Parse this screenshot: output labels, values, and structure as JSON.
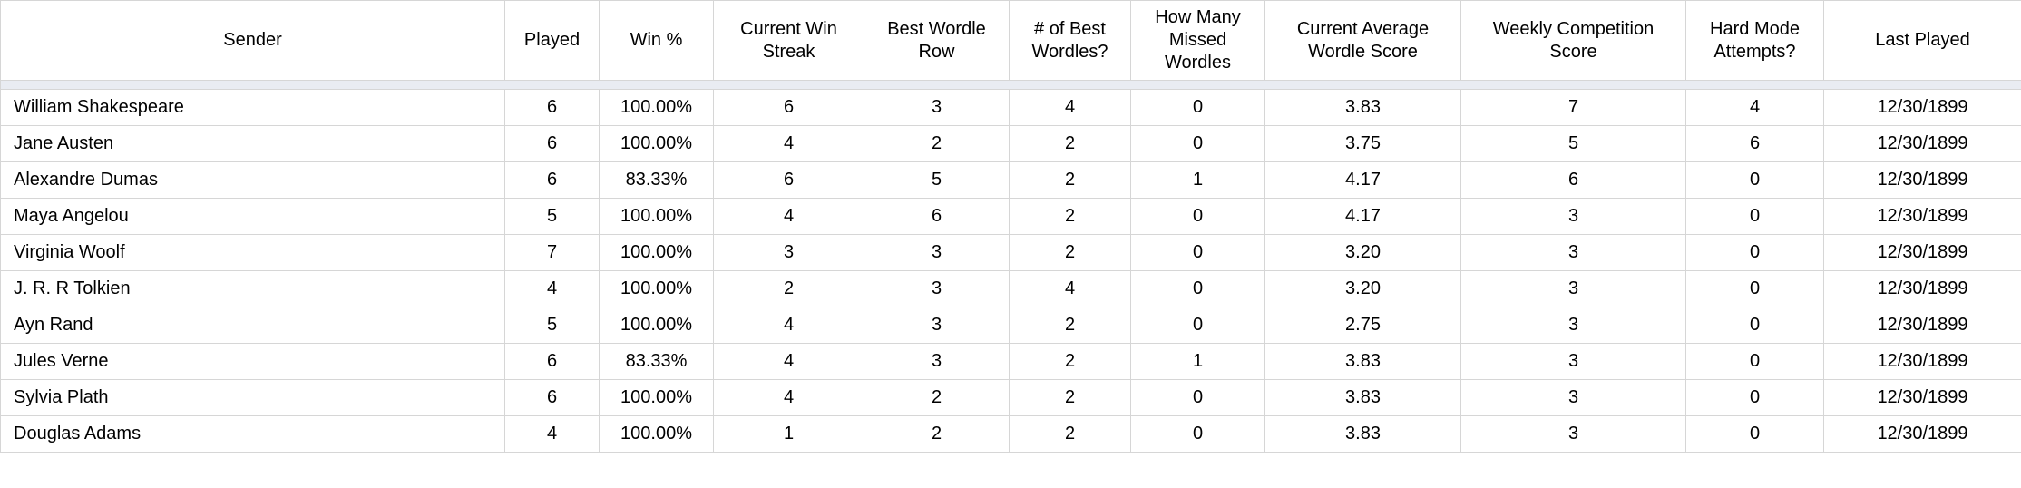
{
  "chart_data": {
    "type": "table",
    "columns": [
      "Sender",
      "Played",
      "Win %",
      "Current Win Streak",
      "Best Wordle Row",
      "# of Best Wordles?",
      "How Many Missed Wordles",
      "Current Average Wordle Score",
      "Weekly Competition Score",
      "Hard Mode Attempts?",
      "Last Played"
    ],
    "rows": [
      [
        "William Shakespeare",
        "6",
        "100.00%",
        "6",
        "3",
        "4",
        "0",
        "3.83",
        "7",
        "4",
        "12/30/1899"
      ],
      [
        "Jane Austen",
        "6",
        "100.00%",
        "4",
        "2",
        "2",
        "0",
        "3.75",
        "5",
        "6",
        "12/30/1899"
      ],
      [
        "Alexandre Dumas",
        "6",
        "83.33%",
        "6",
        "5",
        "2",
        "1",
        "4.17",
        "6",
        "0",
        "12/30/1899"
      ],
      [
        "Maya Angelou",
        "5",
        "100.00%",
        "4",
        "6",
        "2",
        "0",
        "4.17",
        "3",
        "0",
        "12/30/1899"
      ],
      [
        "Virginia Woolf",
        "7",
        "100.00%",
        "3",
        "3",
        "2",
        "0",
        "3.20",
        "3",
        "0",
        "12/30/1899"
      ],
      [
        "J. R. R Tolkien",
        "4",
        "100.00%",
        "2",
        "3",
        "4",
        "0",
        "3.20",
        "3",
        "0",
        "12/30/1899"
      ],
      [
        "Ayn Rand",
        "5",
        "100.00%",
        "4",
        "3",
        "2",
        "0",
        "2.75",
        "3",
        "0",
        "12/30/1899"
      ],
      [
        "Jules Verne",
        "6",
        "83.33%",
        "4",
        "3",
        "2",
        "1",
        "3.83",
        "3",
        "0",
        "12/30/1899"
      ],
      [
        "Sylvia Plath",
        "6",
        "100.00%",
        "4",
        "2",
        "2",
        "0",
        "3.83",
        "3",
        "0",
        "12/30/1899"
      ],
      [
        "Douglas Adams",
        "4",
        "100.00%",
        "1",
        "2",
        "2",
        "0",
        "3.83",
        "3",
        "0",
        "12/30/1899"
      ]
    ]
  }
}
